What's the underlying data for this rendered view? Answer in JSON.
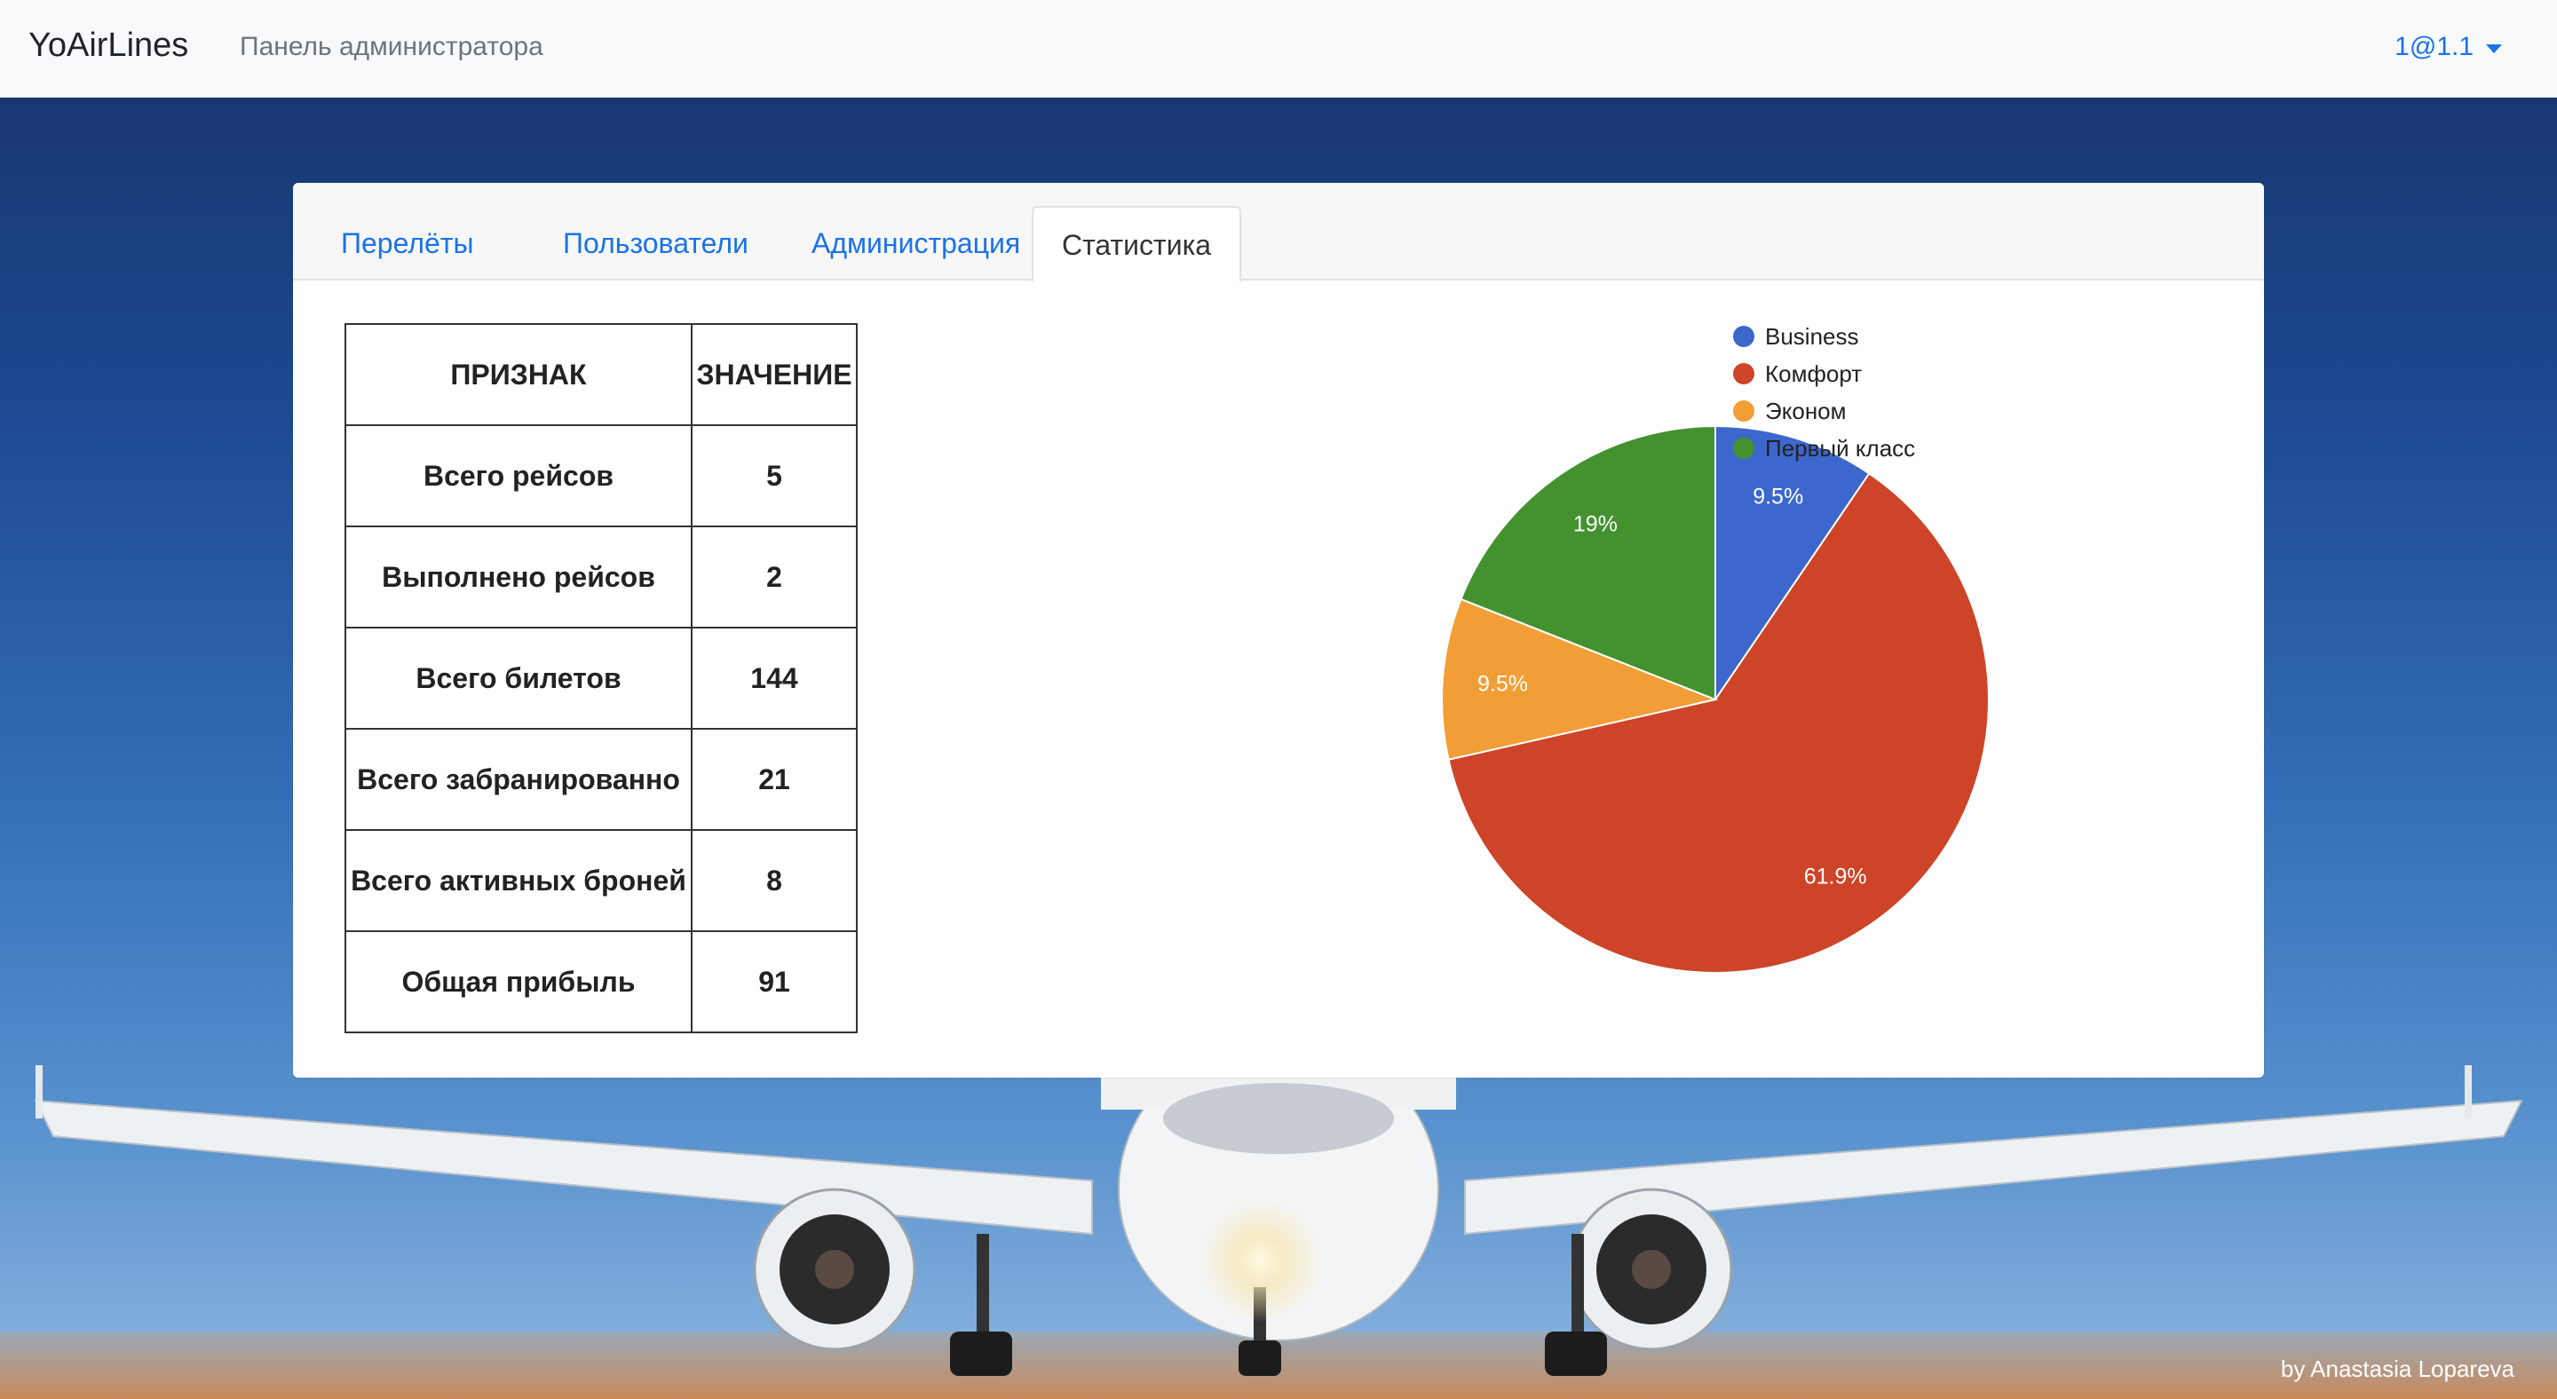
{
  "navbar": {
    "brand": "YoAirLines",
    "subtitle": "Панель администратора",
    "user": "1@1.1"
  },
  "tabs": [
    {
      "label": "Перелёты"
    },
    {
      "label": "Пользователи"
    },
    {
      "label": "Администрация"
    },
    {
      "label": "Статистика",
      "active": true
    }
  ],
  "table": {
    "headers": [
      "ПРИЗНАК",
      "ЗНАЧЕНИЕ"
    ],
    "rows": [
      {
        "label": "Всего рейсов",
        "value": "5"
      },
      {
        "label": "Выполнено рейсов",
        "value": "2"
      },
      {
        "label": "Всего билетов",
        "value": "144"
      },
      {
        "label": "Всего забранированно",
        "value": "21"
      },
      {
        "label": "Всего активных броней",
        "value": "8"
      },
      {
        "label": "Общая прибыль",
        "value": "91"
      }
    ]
  },
  "chart_data": {
    "type": "pie",
    "categories": [
      "Business",
      "Комфорт",
      "Эконом",
      "Первый класс"
    ],
    "values": [
      9.5,
      61.9,
      9.5,
      19
    ],
    "labels": [
      "9.5%",
      "61.9%",
      "9.5%",
      "19%"
    ],
    "colors": [
      "#3d67cc",
      "#cd4428",
      "#f29e37",
      "#43922f"
    ],
    "legend": "right"
  },
  "credit": "by Anastasia Lopareva"
}
